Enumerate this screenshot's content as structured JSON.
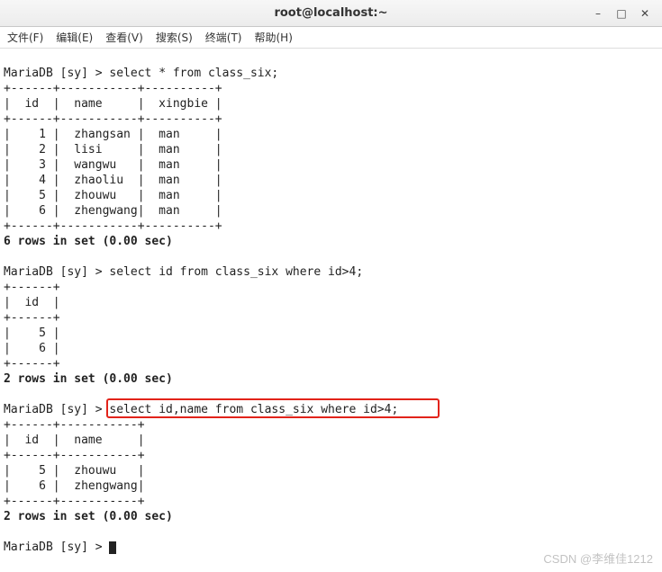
{
  "window": {
    "title": "root@localhost:~"
  },
  "menu": {
    "file": "文件(F)",
    "edit": "编辑(E)",
    "view": "查看(V)",
    "search": "搜索(S)",
    "terminal": "终端(T)",
    "help": "帮助(H)"
  },
  "prompt": "MariaDB [sy] > ",
  "queries": {
    "q1": "select * from class_six;",
    "q2": "select id from class_six where id>4;",
    "q3": "select id,name from class_six where id>4;"
  },
  "table1": {
    "border_top": "+------+-----------+----------+",
    "header": "|  id  |  name     |  xingbie |",
    "rows": [
      "|    1 |  zhangsan |  man     |",
      "|    2 |  lisi     |  man     |",
      "|    3 |  wangwu   |  man     |",
      "|    4 |  zhaoliu  |  man     |",
      "|    5 |  zhouwu   |  man     |",
      "|    6 |  zhengwang|  man     |"
    ],
    "result": "6 rows in set (0.00 sec)"
  },
  "table2": {
    "border": "+------+",
    "header": "|  id  |",
    "rows": [
      "|    5 |",
      "|    6 |"
    ],
    "result": "2 rows in set (0.00 sec)"
  },
  "table3": {
    "border": "+------+-----------+",
    "header": "|  id  |  name     |",
    "rows": [
      "|    5 |  zhouwu   |",
      "|    6 |  zhengwang|"
    ],
    "result": "2 rows in set (0.00 sec)"
  },
  "watermark": "CSDN @李维佳1212",
  "chart_data": {
    "type": "table",
    "tables": [
      {
        "query": "select * from class_six;",
        "columns": [
          "id",
          "name",
          "xingbie"
        ],
        "rows": [
          [
            1,
            "zhangsan",
            "man"
          ],
          [
            2,
            "lisi",
            "man"
          ],
          [
            3,
            "wangwu",
            "man"
          ],
          [
            4,
            "zhaoliu",
            "man"
          ],
          [
            5,
            "zhouwu",
            "man"
          ],
          [
            6,
            "zhengwang",
            "man"
          ]
        ],
        "rows_in_set": 6,
        "time_sec": 0.0
      },
      {
        "query": "select id from class_six where id>4;",
        "columns": [
          "id"
        ],
        "rows": [
          [
            5
          ],
          [
            6
          ]
        ],
        "rows_in_set": 2,
        "time_sec": 0.0
      },
      {
        "query": "select id,name from class_six where id>4;",
        "columns": [
          "id",
          "name"
        ],
        "rows": [
          [
            5,
            "zhouwu"
          ],
          [
            6,
            "zhengwang"
          ]
        ],
        "rows_in_set": 2,
        "time_sec": 0.0
      }
    ]
  }
}
